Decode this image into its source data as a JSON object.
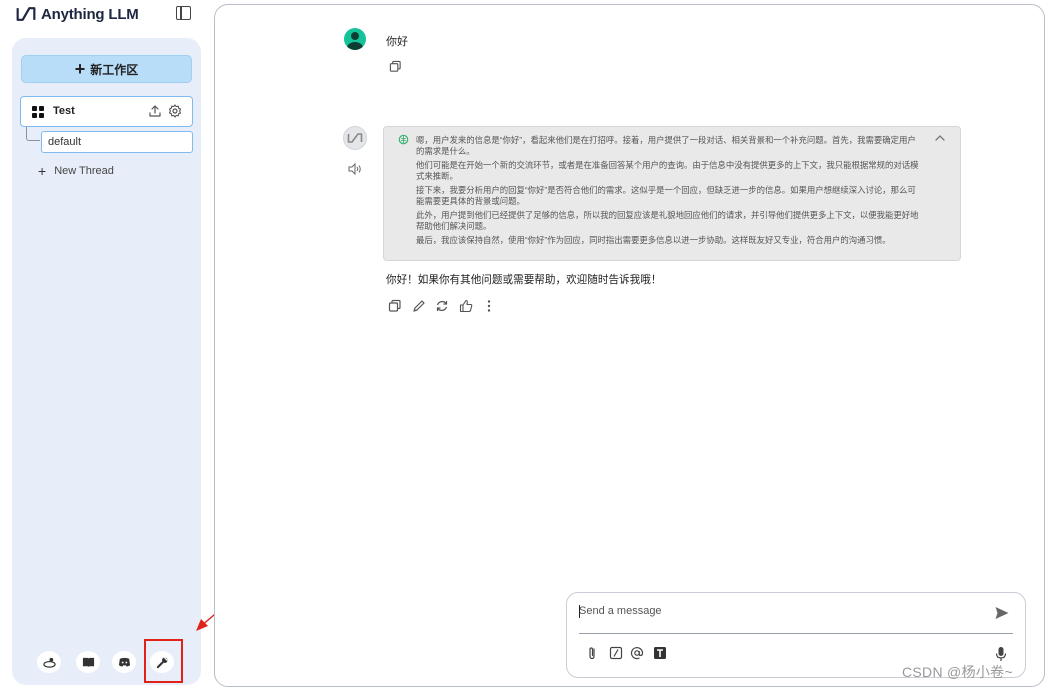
{
  "app": {
    "name": "Anything LLM"
  },
  "sidebar": {
    "new_workspace_label": "新工作区",
    "workspaces": [
      {
        "name": "Test",
        "threads": [
          {
            "name": "default"
          }
        ]
      }
    ],
    "new_thread_label": "New Thread",
    "footer_icons": [
      "community-icon",
      "docs-icon",
      "discord-icon",
      "settings-wrench-icon"
    ]
  },
  "chat": {
    "messages": [
      {
        "role": "user",
        "text": "你好"
      },
      {
        "role": "assistant",
        "thought_paragraphs": [
          "嗯，用户发来的信息是“你好”，看起来他们是在打招呼。接着，用户提供了一段对话、相关背景和一个补充问题。首先，我需要确定用户的需求是什么。",
          "他们可能是在开始一个新的交流环节，或者是在准备回答某个用户的查询。由于信息中没有提供更多的上下文，我只能根据常规的对话模式来推断。",
          "接下来，我要分析用户的回复“你好”是否符合他们的需求。这似乎是一个回应，但缺乏进一步的信息。如果用户想继续深入讨论，那么可能需要更具体的背景或问题。",
          "此外，用户提到他们已经提供了足够的信息，所以我的回复应该是礼貌地回应他们的请求，并引导他们提供更多上下文，以便我能更好地帮助他们解决问题。",
          "最后，我应该保持自然，使用“你好”作为回应，同时指出需要更多信息以进一步协助。这样既友好又专业，符合用户的沟通习惯。"
        ],
        "text": "你好！如果你有其他问题或需要帮助，欢迎随时告诉我哦！"
      }
    ]
  },
  "composer": {
    "placeholder": "Send a message"
  },
  "annotation": {
    "marker": "①"
  },
  "watermark": "CSDN @杨小卷~",
  "colors": {
    "sidebar_bg": "#e8eef9",
    "new_workspace_bg": "#b7ddf9",
    "active_border": "#7fbaf0",
    "user_avatar": "#14c39a",
    "annotation_red": "#e0221b"
  }
}
